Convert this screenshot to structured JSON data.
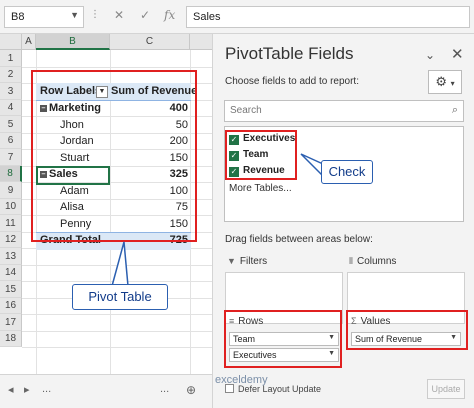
{
  "formula_bar": {
    "name_box": "B8",
    "cancel_icon": "✕",
    "enter_icon": "✓",
    "fx_label": "fx",
    "value": "Sales"
  },
  "grid": {
    "columns": [
      "A",
      "B",
      "C"
    ],
    "rows": [
      "1",
      "2",
      "3",
      "4",
      "5",
      "6",
      "7",
      "8",
      "9",
      "10",
      "11",
      "12",
      "13",
      "14",
      "15",
      "16",
      "17",
      "18"
    ],
    "selected_cell": "B8"
  },
  "pivot_table": {
    "header": {
      "row_labels": "Row Labels",
      "value_header": "Sum of Revenue"
    },
    "rows": [
      {
        "label": "Marketing",
        "value": "400",
        "group": true
      },
      {
        "label": "Jhon",
        "value": "50",
        "group": false
      },
      {
        "label": "Jordan",
        "value": "200",
        "group": false
      },
      {
        "label": "Stuart",
        "value": "150",
        "group": false
      },
      {
        "label": "Sales",
        "value": "325",
        "group": true
      },
      {
        "label": "Adam",
        "value": "100",
        "group": false
      },
      {
        "label": "Alisa",
        "value": "75",
        "group": false
      },
      {
        "label": "Penny",
        "value": "150",
        "group": false
      }
    ],
    "grand_total": {
      "label": "Grand Total",
      "value": "725"
    }
  },
  "callouts": {
    "pivot_table": "Pivot Table",
    "check": "Check"
  },
  "sheet_tabs": {
    "items": [
      "◂",
      "▸",
      "...",
      "..."
    ]
  },
  "pivot_fields": {
    "title": "PivotTable Fields",
    "choose_label": "Choose fields to add to report:",
    "search_placeholder": "Search",
    "fields": [
      {
        "name": "Executives",
        "checked": true
      },
      {
        "name": "Team",
        "checked": true
      },
      {
        "name": "Revenue",
        "checked": true
      }
    ],
    "more_tables": "More Tables...",
    "drag_label": "Drag fields between areas below:",
    "areas": {
      "filters": {
        "label": "Filters"
      },
      "columns": {
        "label": "Columns"
      },
      "rows": {
        "label": "Rows",
        "items": [
          "Team",
          "Executives"
        ]
      },
      "values": {
        "label": "Values",
        "items": [
          "Sum of Revenue"
        ]
      }
    },
    "defer_label": "Defer Layout Update",
    "update_label": "Update"
  },
  "watermark": "exceldemy"
}
